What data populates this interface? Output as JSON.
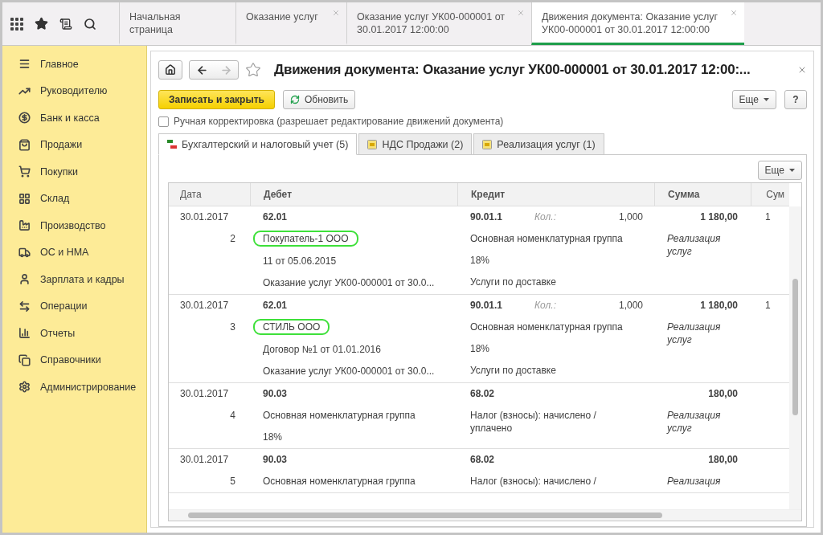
{
  "top_tabs": [
    {
      "label": "Начальная страница",
      "closable": false,
      "selected": false
    },
    {
      "label": "Оказание услуг",
      "closable": true,
      "selected": false
    },
    {
      "label": "Оказание услуг УК00-000001 от 30.01.2017 12:00:00",
      "closable": true,
      "selected": false
    },
    {
      "label": "Движения документа: Оказание услуг УК00-000001 от 30.01.2017 12:00:00",
      "closable": true,
      "selected": true
    }
  ],
  "sidebar": {
    "items": [
      {
        "label": "Главное"
      },
      {
        "label": "Руководителю"
      },
      {
        "label": "Банк и касса"
      },
      {
        "label": "Продажи"
      },
      {
        "label": "Покупки"
      },
      {
        "label": "Склад"
      },
      {
        "label": "Производство"
      },
      {
        "label": "ОС и НМА"
      },
      {
        "label": "Зарплата и кадры"
      },
      {
        "label": "Операции"
      },
      {
        "label": "Отчеты"
      },
      {
        "label": "Справочники"
      },
      {
        "label": "Администрирование"
      }
    ]
  },
  "form": {
    "title": "Движения документа: Оказание услуг УК00-000001 от 30.01.2017 12:00:...",
    "buttons": [
      {
        "label": "Записать и закрыть",
        "kind": "primary"
      },
      {
        "label": "Обновить",
        "kind": "refresh"
      }
    ],
    "more_button": "Еще",
    "help_button": "?",
    "manual_edit": {
      "label": "Ручная корректировка (разрешает редактирование движений документа)",
      "checked": false
    },
    "tabs": [
      {
        "label": "Бухгалтерский и налоговый учет (5)",
        "selected": true
      },
      {
        "label": "НДС Продажи (2)",
        "selected": false
      },
      {
        "label": "Реализация услуг (1)",
        "selected": false
      }
    ],
    "table_more_button": "Еще",
    "table": {
      "columns": [
        "Дата",
        "Дебет",
        "Кредит",
        "Сумма",
        "Сум"
      ],
      "rows": [
        {
          "date": "30.01.2017",
          "number": "2",
          "debit_account": "62.01",
          "debit_details": [
            {
              "text": "Покупатель-1 ООО",
              "circled": true
            },
            {
              "text": "11 от 05.06.2015",
              "circled": false
            },
            {
              "text": "Оказание услуг УК00-000001 от 30.0...",
              "circled": false
            }
          ],
          "credit_account": "90.01.1",
          "qty_label": "Кол.:",
          "qty": "1,000",
          "credit_details": [
            "Основная номенклатурная группа",
            "18%",
            "Услуги по доставке"
          ],
          "sum": "1 180,00",
          "sum_note": "Реализация услуг",
          "column_5": "1"
        },
        {
          "date": "30.01.2017",
          "number": "3",
          "debit_account": "62.01",
          "debit_details": [
            {
              "text": "СТИЛЬ ООО",
              "circled": true
            },
            {
              "text": "Договор №1 от 01.01.2016",
              "circled": false
            },
            {
              "text": "Оказание услуг УК00-000001 от 30.0...",
              "circled": false
            }
          ],
          "credit_account": "90.01.1",
          "qty_label": "Кол.:",
          "qty": "1,000",
          "credit_details": [
            "Основная номенклатурная группа",
            "18%",
            "Услуги по доставке"
          ],
          "sum": "1 180,00",
          "sum_note": "Реализация услуг",
          "column_5": "1"
        },
        {
          "date": "30.01.2017",
          "number": "4",
          "debit_account": "90.03",
          "debit_details": [
            {
              "text": "Основная номенклатурная группа",
              "circled": false
            },
            {
              "text": "18%",
              "circled": false
            }
          ],
          "credit_account": "68.02",
          "credit_details": [
            "Налог (взносы): начислено / уплачено"
          ],
          "sum": "180,00",
          "sum_note": "Реализация услуг"
        },
        {
          "date": "30.01.2017",
          "number": "5",
          "debit_account": "90.03",
          "debit_details": [
            {
              "text": "Основная номенклатурная группа",
              "circled": false
            }
          ],
          "credit_account": "68.02",
          "credit_details": [
            "Налог (взносы): начислено /"
          ],
          "sum": "180,00",
          "sum_note": "Реализация"
        }
      ]
    }
  }
}
